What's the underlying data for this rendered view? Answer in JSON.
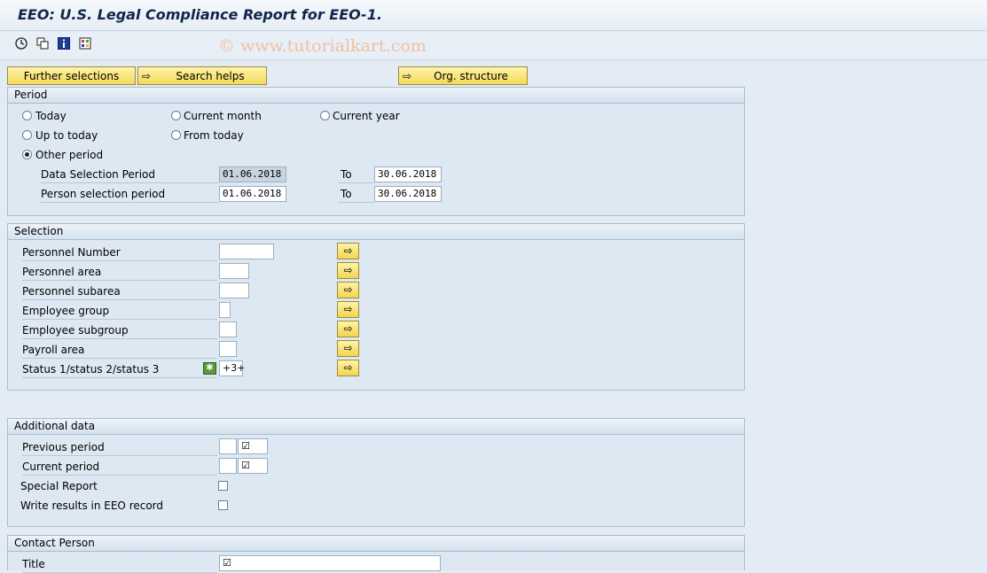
{
  "window": {
    "title": "EEO: U.S. Legal Compliance Report for EEO-1."
  },
  "toolbar": {
    "icons": [
      "execute-icon",
      "variant-icon",
      "info-icon",
      "layout-icon"
    ],
    "watermark": "© www.tutorialkart.com"
  },
  "topbuttons": {
    "further": "Further selections",
    "search": "Search helps",
    "org": "Org. structure"
  },
  "period": {
    "heading": "Period",
    "today": "Today",
    "current_month": "Current month",
    "current_year": "Current year",
    "up_to_today": "Up to today",
    "from_today": "From today",
    "other_period": "Other period",
    "data_sel_label": "Data Selection Period",
    "data_sel_from": "01.06.2018",
    "data_sel_to": "30.06.2018",
    "person_sel_label": "Person selection period",
    "person_sel_from": "01.06.2018",
    "person_sel_to": "30.06.2018",
    "to_label": "To",
    "selected": "other_period"
  },
  "selection": {
    "heading": "Selection",
    "rows": [
      {
        "label": "Personnel Number",
        "value": ""
      },
      {
        "label": "Personnel area",
        "value": ""
      },
      {
        "label": "Personnel subarea",
        "value": ""
      },
      {
        "label": "Employee group",
        "value": ""
      },
      {
        "label": "Employee subgroup",
        "value": ""
      },
      {
        "label": "Payroll area",
        "value": ""
      },
      {
        "label": "Status 1/status 2/status 3",
        "value": "+3+"
      }
    ]
  },
  "additional": {
    "heading": "Additional data",
    "previous_period": "Previous period",
    "current_period": "Current period",
    "special_report": "Special Report",
    "write_results": "Write results in EEO record",
    "check_mark": "☑"
  },
  "contact": {
    "heading": "Contact Person",
    "title_label": "Title"
  }
}
